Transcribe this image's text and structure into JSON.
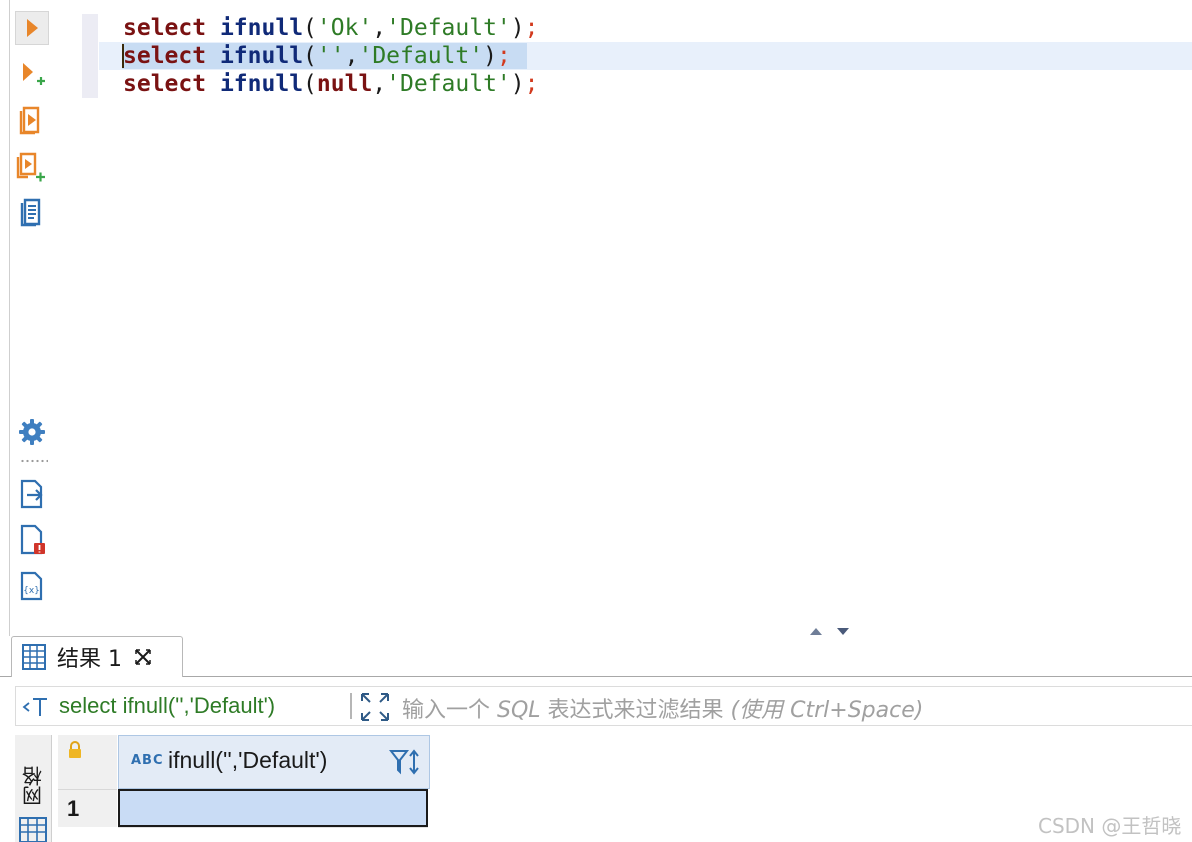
{
  "editor": {
    "lines": [
      {
        "kw": "select",
        "fn": "ifnull",
        "open": "(",
        "arg1": "'Ok'",
        "comma": ",",
        "arg2": "'Default'",
        "close": ")",
        "semi": ";"
      },
      {
        "kw": "select",
        "fn": "ifnull",
        "open": "(",
        "arg1": "''",
        "comma": ",",
        "arg2": "'Default'",
        "close": ")",
        "semi": ";"
      },
      {
        "kw": "select",
        "fn": "ifnull",
        "open": "(",
        "arg1": "null",
        "comma": ",",
        "arg2": "'Default'",
        "close": ")",
        "semi": ";"
      }
    ],
    "current_line": 2
  },
  "toolbar": {
    "icons": [
      "execute-statement-icon",
      "execute-in-new-tab-icon",
      "execute-script-icon",
      "execute-script-new-tab-icon",
      "explain-plan-icon",
      "settings-gear-icon",
      "export-icon",
      "problems-icon",
      "variables-icon"
    ]
  },
  "results": {
    "tab_label": "结果 1",
    "filter_query": "select ifnull('','Default')",
    "filter_placeholder_prefix": "输入一个 ",
    "filter_placeholder_sql": "SQL",
    "filter_placeholder_mid": " 表达式来过滤结果 ",
    "filter_placeholder_hint": "(使用 Ctrl+Space)",
    "grid_tab_label": "网格",
    "column_type_badge": "ABC",
    "column_name": "ifnull('','Default')",
    "rows": [
      {
        "num": "1",
        "value": ""
      }
    ]
  },
  "watermark": "CSDN @王哲晓"
}
